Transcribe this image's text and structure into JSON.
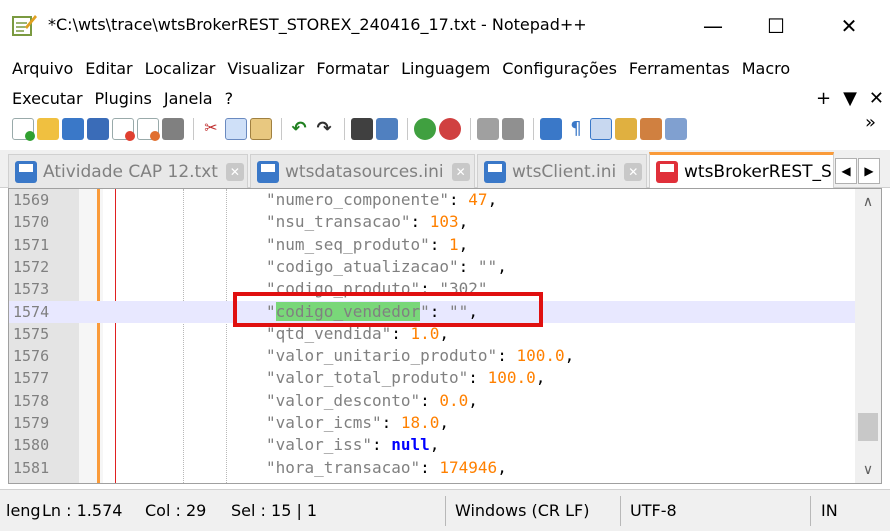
{
  "window": {
    "title": "*C:\\wts\\trace\\wtsBrokerREST_STOREX_240416_17.txt - Notepad++",
    "minimize": "—",
    "maximize": "☐",
    "close": "✕"
  },
  "menu": {
    "row1": [
      "Arquivo",
      "Editar",
      "Localizar",
      "Visualizar",
      "Formatar",
      "Linguagem",
      "Configurações",
      "Ferramentas",
      "Macro"
    ],
    "row2": [
      "Executar",
      "Plugins",
      "Janela",
      "?"
    ],
    "right_controls": [
      "+",
      "▼",
      "✕"
    ]
  },
  "toolbar": {
    "icons": [
      "new-file-icon",
      "open-file-icon",
      "save-icon",
      "save-all-icon",
      "close-icon",
      "close-all-icon",
      "print-icon",
      "cut-icon",
      "copy-icon",
      "paste-icon",
      "undo-icon",
      "redo-icon",
      "find-icon",
      "replace-icon",
      "zoom-in-icon",
      "zoom-out-icon",
      "sync-vertical-icon",
      "sync-horizontal-icon",
      "word-wrap-icon",
      "show-all-chars-icon",
      "indent-guide-icon",
      "user-lang-icon",
      "doc-map-icon",
      "function-list-icon"
    ],
    "more": "»"
  },
  "tabs": [
    {
      "label": "Atividade CAP 12.txt",
      "active": false
    },
    {
      "label": "wtsdatasources.ini",
      "active": false
    },
    {
      "label": "wtsClient.ini",
      "active": false
    },
    {
      "label": "wtsBrokerREST_S",
      "active": true
    }
  ],
  "tab_scroll": {
    "left": "◀",
    "right": "▶"
  },
  "editor": {
    "lines": [
      {
        "num": "1569",
        "key": "\"numero_componente\"",
        "sep": ": ",
        "value": "47",
        "vtype": "n",
        "tail": ","
      },
      {
        "num": "1570",
        "key": "\"nsu_transacao\"",
        "sep": ": ",
        "value": "103",
        "vtype": "n",
        "tail": ","
      },
      {
        "num": "1571",
        "key": "\"num_seq_produto\"",
        "sep": ": ",
        "value": "1",
        "vtype": "n",
        "tail": ","
      },
      {
        "num": "1572",
        "key": "\"codigo_atualizacao\"",
        "sep": ": ",
        "value": "\"\"",
        "vtype": "k",
        "tail": ","
      },
      {
        "num": "1573",
        "key": "\"codigo_produto\"",
        "sep": ": ",
        "value": "\"302\"",
        "vtype": "k",
        "tail": ""
      },
      {
        "num": "1574",
        "key_pre": "\"",
        "key_sel": "codigo_vendedor",
        "key_post": "\"",
        "sep": ": ",
        "value": "\"\"",
        "vtype": "k",
        "tail": ","
      },
      {
        "num": "1575",
        "key": "\"qtd_vendida\"",
        "sep": ": ",
        "value": "1.0",
        "vtype": "n",
        "tail": ","
      },
      {
        "num": "1576",
        "key": "\"valor_unitario_produto\"",
        "sep": ": ",
        "value": "100.0",
        "vtype": "n",
        "tail": ","
      },
      {
        "num": "1577",
        "key": "\"valor_total_produto\"",
        "sep": ": ",
        "value": "100.0",
        "vtype": "n",
        "tail": ","
      },
      {
        "num": "1578",
        "key": "\"valor_desconto\"",
        "sep": ": ",
        "value": "0.0",
        "vtype": "n",
        "tail": ","
      },
      {
        "num": "1579",
        "key": "\"valor_icms\"",
        "sep": ": ",
        "value": "18.0",
        "vtype": "n",
        "tail": ","
      },
      {
        "num": "1580",
        "key": "\"valor_iss\"",
        "sep": ": ",
        "value": "null",
        "vtype": "kw",
        "tail": ","
      },
      {
        "num": "1581",
        "key": "\"hora_transacao\"",
        "sep": ": ",
        "value": "174946",
        "vtype": "n",
        "tail": ","
      }
    ],
    "current_line": "1574"
  },
  "status": {
    "length": "leng",
    "ln": "Ln : 1.574",
    "col": "Col : 29",
    "sel": "Sel : 15 | 1",
    "eol": "Windows (CR LF)",
    "encoding": "UTF-8",
    "mode": "IN"
  },
  "colors": {
    "accent_tab": "#fa9b3a",
    "string": "#808080",
    "number": "#ff8000",
    "keyword": "#0000ff",
    "selection": "#79d779",
    "annotation_box": "#e01010"
  }
}
